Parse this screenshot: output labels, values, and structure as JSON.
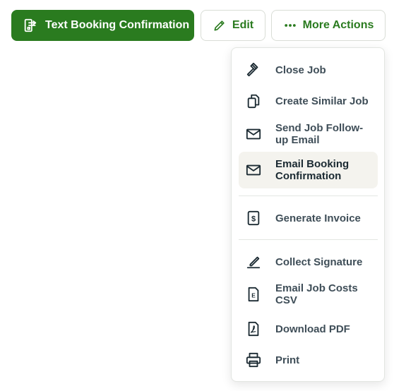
{
  "toolbar": {
    "text_booking_label": "Text Booking Confirmation",
    "edit_label": "Edit",
    "more_actions_label": "More Actions",
    "accent_color": "#2a7b1f"
  },
  "menu": {
    "items": [
      {
        "label": "Close Job",
        "icon": "gavel-icon"
      },
      {
        "label": "Create Similar Job",
        "icon": "copy-icon"
      },
      {
        "label": "Send Job Follow-up Email",
        "icon": "mail-icon"
      },
      {
        "label": "Email Booking Confirmation",
        "icon": "mail-icon",
        "active": true
      },
      {
        "label": "Generate Invoice",
        "icon": "invoice-icon"
      },
      {
        "label": "Collect Signature",
        "icon": "signature-icon"
      },
      {
        "label": "Email Job Costs CSV",
        "icon": "csv-file-icon"
      },
      {
        "label": "Download PDF",
        "icon": "pdf-file-icon"
      },
      {
        "label": "Print",
        "icon": "printer-icon"
      }
    ]
  }
}
